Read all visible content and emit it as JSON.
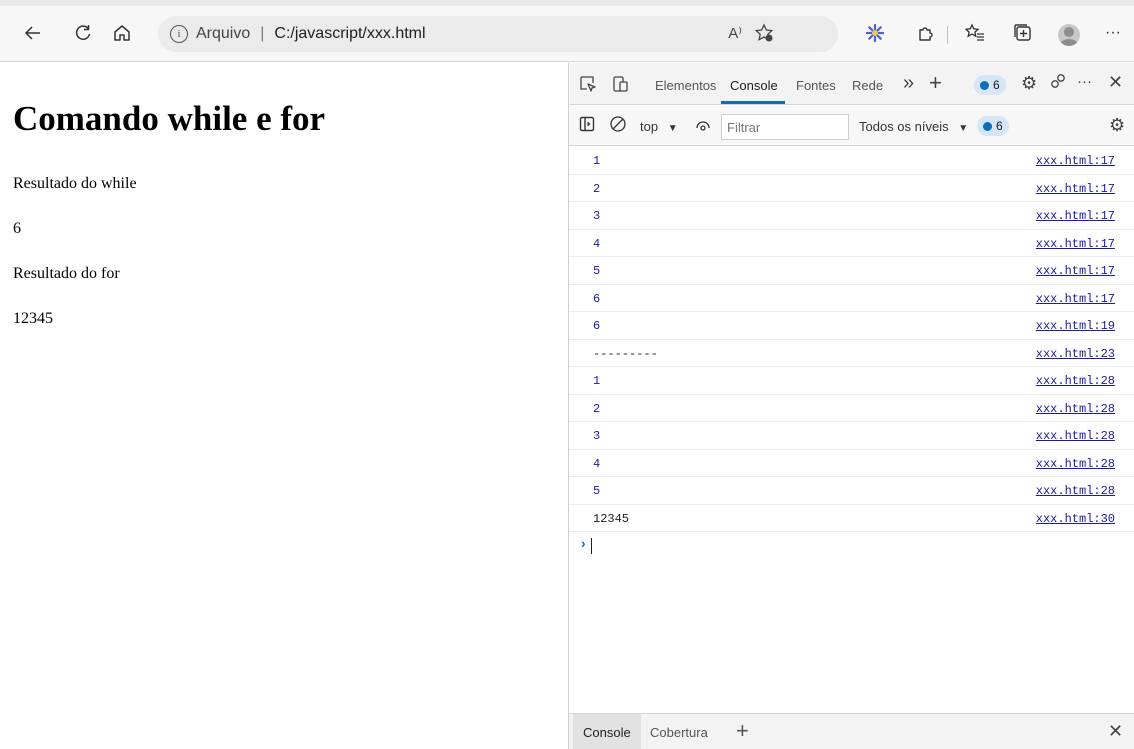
{
  "browser": {
    "address_label": "Arquivo",
    "url": "C:/javascript/xxx.html",
    "read_aloud_label": "A⁾"
  },
  "page": {
    "heading": "Comando while e for",
    "lines": [
      "Resultado do while",
      "6",
      "Resultado do for",
      "12345"
    ]
  },
  "devtools": {
    "tabs": [
      "Elementos",
      "Console",
      "Fontes",
      "Rede"
    ],
    "active_tab": "Console",
    "issues_count": "6",
    "context": "top",
    "filter_placeholder": "Filtrar",
    "levels": "Todos os níveis",
    "levels_count": "6",
    "log": [
      {
        "msg": "1",
        "src": "xxx.html:17",
        "kind": "num"
      },
      {
        "msg": "2",
        "src": "xxx.html:17",
        "kind": "num"
      },
      {
        "msg": "3",
        "src": "xxx.html:17",
        "kind": "num"
      },
      {
        "msg": "4",
        "src": "xxx.html:17",
        "kind": "num"
      },
      {
        "msg": "5",
        "src": "xxx.html:17",
        "kind": "num"
      },
      {
        "msg": "6",
        "src": "xxx.html:17",
        "kind": "num"
      },
      {
        "msg": "6",
        "src": "xxx.html:19",
        "kind": "num"
      },
      {
        "msg": "---------",
        "src": "xxx.html:23",
        "kind": "txt"
      },
      {
        "msg": "1",
        "src": "xxx.html:28",
        "kind": "num"
      },
      {
        "msg": "2",
        "src": "xxx.html:28",
        "kind": "num"
      },
      {
        "msg": "3",
        "src": "xxx.html:28",
        "kind": "num"
      },
      {
        "msg": "4",
        "src": "xxx.html:28",
        "kind": "num"
      },
      {
        "msg": "5",
        "src": "xxx.html:28",
        "kind": "num"
      },
      {
        "msg": "12345",
        "src": "xxx.html:30",
        "kind": "txt"
      }
    ],
    "drawer_tabs": [
      "Console",
      "Cobertura"
    ]
  },
  "colors": {
    "accent": "#0f6cbd",
    "log_number": "#1a1aa6"
  }
}
